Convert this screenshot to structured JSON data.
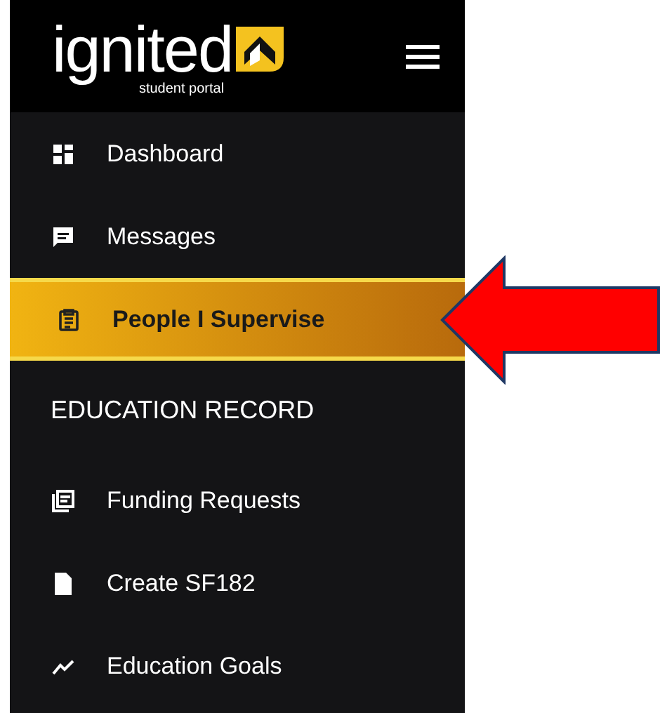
{
  "logo": {
    "wordmark": "ignited",
    "tagline": "student portal"
  },
  "nav": [
    {
      "kind": "item",
      "label": "Dashboard",
      "selected": false
    },
    {
      "kind": "item",
      "label": "Messages",
      "selected": false
    },
    {
      "kind": "item",
      "label": "People I Supervise",
      "selected": true
    },
    {
      "kind": "heading",
      "label": "EDUCATION RECORD"
    },
    {
      "kind": "item",
      "label": "Funding Requests",
      "selected": false
    },
    {
      "kind": "item",
      "label": "Create SF182",
      "selected": false
    },
    {
      "kind": "item",
      "label": "Education Goals",
      "selected": false
    }
  ]
}
